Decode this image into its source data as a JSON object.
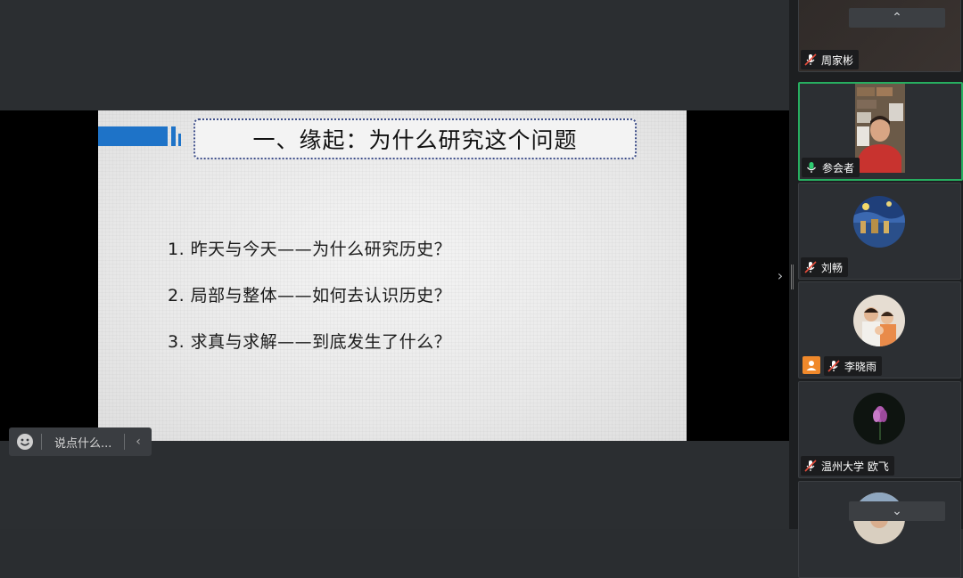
{
  "slide": {
    "title": "一、缘起：为什么研究这个问题",
    "items": [
      "1. 昨天与今天——为什么研究历史？",
      "2. 局部与整体——如何去认识历史？",
      "3. 求真与求解——到底发生了什么？"
    ],
    "accent_color": "#1e73c8"
  },
  "chat": {
    "placeholder": "说点什么...",
    "emoji_icon": "emoji-icon",
    "collapse_icon": "chevron-left-icon"
  },
  "stage": {
    "expand_icon": "chevron-right-icon"
  },
  "participants": [
    {
      "name": "周家彬",
      "mic": "muted"
    },
    {
      "name": "参会者",
      "mic": "active"
    },
    {
      "name": "刘畅",
      "mic": "muted"
    },
    {
      "name": "李晓雨",
      "mic": "muted"
    },
    {
      "name": "温州大学  欧飞",
      "mic": "muted"
    },
    {
      "name": "",
      "mic": "muted"
    }
  ],
  "panel": {
    "scroll_up_icon": "chevron-up-icon",
    "scroll_down_icon": "chevron-down-icon",
    "active_border_color": "#27ae60"
  }
}
